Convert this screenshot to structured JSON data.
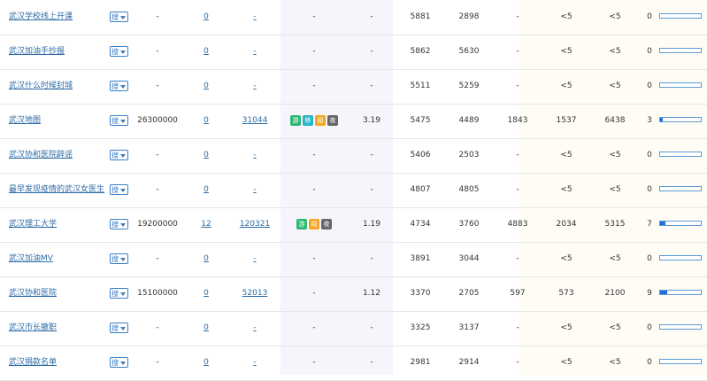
{
  "rows": [
    {
      "keyword": "武汉学校线上开课",
      "sou": "搜",
      "col3": "-",
      "col4": "0",
      "col5": "-",
      "badges": [],
      "col7": "-",
      "col8": "-",
      "col9": "5881",
      "col10": "2898",
      "col11": "-",
      "col12": "<5",
      "col13": "<5",
      "rank": "0",
      "bar": 0
    },
    {
      "keyword": "武汉加油手抄报",
      "sou": "搜",
      "col3": "-",
      "col4": "0",
      "col5": "-",
      "badges": [],
      "col7": "-",
      "col8": "-",
      "col9": "5862",
      "col10": "5630",
      "col11": "-",
      "col12": "<5",
      "col13": "<5",
      "rank": "0",
      "bar": 0
    },
    {
      "keyword": "武汉什么时候封城",
      "sou": "搜",
      "col3": "-",
      "col4": "0",
      "col5": "-",
      "badges": [],
      "col7": "-",
      "col8": "-",
      "col9": "5511",
      "col10": "5259",
      "col11": "-",
      "col12": "<5",
      "col13": "<5",
      "rank": "0",
      "bar": 0
    },
    {
      "keyword": "武汉地图",
      "sou": "搜",
      "col3": "26300000",
      "col4": "0",
      "col5": "31044",
      "badges": [
        {
          "t": "游",
          "c": "b-green"
        },
        {
          "t": "移",
          "c": "b-teal"
        },
        {
          "t": "阅",
          "c": "b-orange"
        },
        {
          "t": "夜",
          "c": "b-gray"
        }
      ],
      "col7": "",
      "col8": "3.19",
      "col9": "5475",
      "col10": "4489",
      "col11": "1843",
      "col12": "1537",
      "col13": "6438",
      "rank": "3",
      "bar": 0.06
    },
    {
      "keyword": "武汉协和医院辟谣",
      "sou": "搜",
      "col3": "-",
      "col4": "0",
      "col5": "-",
      "badges": [],
      "col7": "-",
      "col8": "-",
      "col9": "5406",
      "col10": "2503",
      "col11": "-",
      "col12": "<5",
      "col13": "<5",
      "rank": "0",
      "bar": 0
    },
    {
      "keyword": "最早发现疫情的武汉女医生",
      "sou": "搜",
      "col3": "-",
      "col4": "0",
      "col5": "-",
      "badges": [],
      "col7": "-",
      "col8": "-",
      "col9": "4807",
      "col10": "4805",
      "col11": "-",
      "col12": "<5",
      "col13": "<5",
      "rank": "0",
      "bar": 0
    },
    {
      "keyword": "武汉理工大学",
      "sou": "搜",
      "col3": "19200000",
      "col4": "12",
      "col5": "120321",
      "badges": [
        {
          "t": "游",
          "c": "b-green"
        },
        {
          "t": "阅",
          "c": "b-orange"
        },
        {
          "t": "夜",
          "c": "b-gray"
        }
      ],
      "col7": "",
      "col8": "1.19",
      "col9": "4734",
      "col10": "3760",
      "col11": "4883",
      "col12": "2034",
      "col13": "5315",
      "rank": "7",
      "bar": 0.14
    },
    {
      "keyword": "武汉加油MV",
      "sou": "搜",
      "col3": "-",
      "col4": "0",
      "col5": "-",
      "badges": [],
      "col7": "-",
      "col8": "-",
      "col9": "3891",
      "col10": "3044",
      "col11": "-",
      "col12": "<5",
      "col13": "<5",
      "rank": "0",
      "bar": 0
    },
    {
      "keyword": "武汉协和医院",
      "sou": "搜",
      "col3": "15100000",
      "col4": "0",
      "col5": "52013",
      "badges": [],
      "col7": "-",
      "col8": "1.12",
      "col9": "3370",
      "col10": "2705",
      "col11": "597",
      "col12": "573",
      "col13": "2100",
      "rank": "9",
      "bar": 0.18
    },
    {
      "keyword": "武汉市长撤职",
      "sou": "搜",
      "col3": "-",
      "col4": "0",
      "col5": "-",
      "badges": [],
      "col7": "-",
      "col8": "-",
      "col9": "3325",
      "col10": "3137",
      "col11": "-",
      "col12": "<5",
      "col13": "<5",
      "rank": "0",
      "bar": 0
    },
    {
      "keyword": "武汉捐款名单",
      "sou": "搜",
      "col3": "-",
      "col4": "0",
      "col5": "-",
      "badges": [],
      "col7": "-",
      "col8": "-",
      "col9": "2981",
      "col10": "2914",
      "col11": "-",
      "col12": "<5",
      "col13": "<5",
      "rank": "0",
      "bar": 0
    }
  ]
}
